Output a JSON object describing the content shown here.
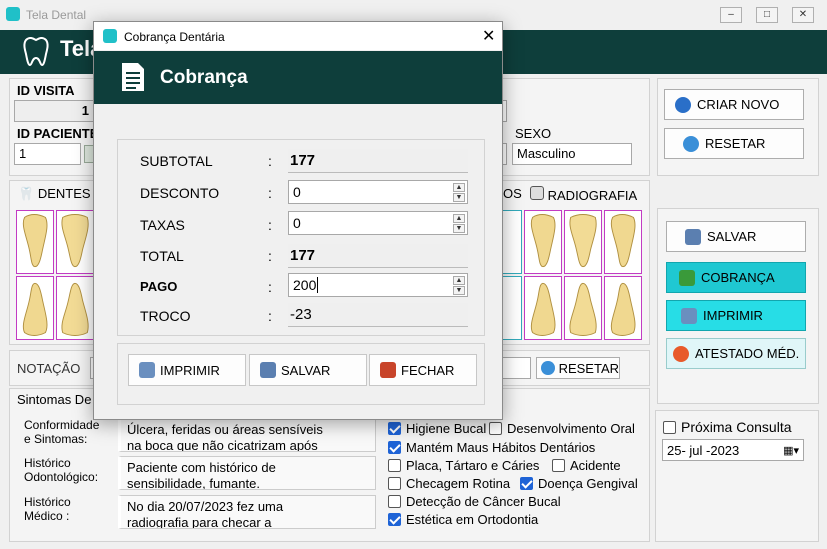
{
  "app": {
    "title": "Tela Dental",
    "header": "Tela"
  },
  "visit": {
    "id_visita_label": "ID VISITA",
    "id_visita": "1",
    "id_paciente_label": "ID PACIENTE",
    "id_paciente": "1",
    "sexo_label": "SEXO",
    "sexo": "Masculino"
  },
  "tabs": {
    "dentes": "DENTES",
    "radiografia": "RADIOGRAFIA",
    "radiografia_prefix": "OS"
  },
  "right_buttons": {
    "criar_novo": "CRIAR NOVO",
    "resetar": "RESETAR",
    "salvar": "SALVAR",
    "cobranca": "COBRANÇA",
    "imprimir": "IMPRIMIR",
    "atestado": "ATESTADO MÉD."
  },
  "notacao": {
    "label": "NOTAÇÃO",
    "reset": "RESETAR"
  },
  "sintomas": {
    "section": "Sintomas De",
    "rows": [
      {
        "label1": "Conformidade",
        "label2": "e Sintomas:",
        "text1": "Úlcera, feridas ou áreas sensíveis",
        "text2": "na boca que não cicatrizam após"
      },
      {
        "label1": "Histórico",
        "label2": "Odontológico:",
        "text1": "Paciente com histórico de",
        "text2": "sensibilidade, fumante."
      },
      {
        "label1": "Histórico",
        "label2": "Médico :",
        "text1": "No dia 20/07/2023 fez uma",
        "text2": "radiografia para checar a"
      }
    ]
  },
  "checks": [
    {
      "label": "Higiene Bucal",
      "on": true
    },
    {
      "label": "Desenvolvimento Oral",
      "on": false
    },
    {
      "label": "Mantém Maus Hábitos Dentários",
      "on": true
    },
    {
      "label": "Placa, Tártaro e Cáries",
      "on": false
    },
    {
      "label": "Acidente",
      "on": false
    },
    {
      "label": "Checagem Rotina",
      "on": false
    },
    {
      "label": "Doença Gengival",
      "on": true
    },
    {
      "label": "Detecção de Câncer Bucal",
      "on": false
    },
    {
      "label": "Estética em Ortodontia",
      "on": true
    }
  ],
  "proxima": {
    "label": "Próxima Consulta",
    "date": "25- jul -2023"
  },
  "modal": {
    "window_title": "Cobrança Dentária",
    "header": "Cobrança",
    "subtotal_label": "SUBTOTAL",
    "subtotal": "177",
    "desconto_label": "DESCONTO",
    "desconto": "0",
    "taxas_label": "TAXAS",
    "taxas": "0",
    "total_label": "TOTAL",
    "total": "177",
    "pago_label": "PAGO",
    "pago": "200",
    "troco_label": "TROCO",
    "troco": "-23",
    "colon": ":",
    "btn_imprimir": "IMPRIMIR",
    "btn_salvar": "SALVAR",
    "btn_fechar": "FECHAR"
  },
  "colors": {
    "header": "#0e3e3b",
    "accent": "#1fc8d2",
    "tooth_border": "#c23bc3"
  }
}
